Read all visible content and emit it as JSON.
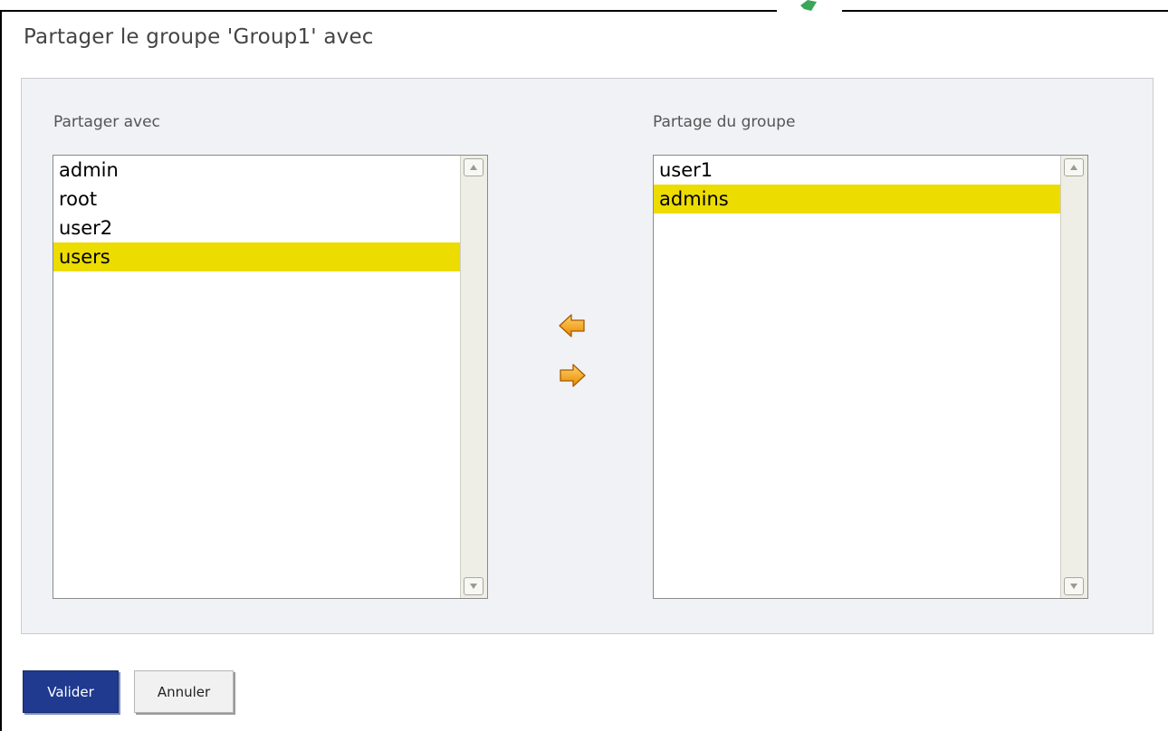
{
  "dialog": {
    "title": "Partager le groupe 'Group1' avec"
  },
  "left_list": {
    "label": "Partager avec",
    "items": [
      {
        "label": "admin",
        "selected": false
      },
      {
        "label": "root",
        "selected": false
      },
      {
        "label": "user2",
        "selected": false
      },
      {
        "label": "users",
        "selected": true
      }
    ]
  },
  "right_list": {
    "label": "Partage du groupe",
    "items": [
      {
        "label": "user1",
        "selected": false
      },
      {
        "label": "admins",
        "selected": true
      }
    ]
  },
  "transfer": {
    "move_left_icon": "arrow-left-icon",
    "move_right_icon": "arrow-right-icon"
  },
  "buttons": {
    "submit_label": "Valider",
    "cancel_label": "Annuler"
  },
  "colors": {
    "selection": "#ecdc00",
    "primary_button": "#1f3a8f",
    "arrow": "#f0a020"
  }
}
